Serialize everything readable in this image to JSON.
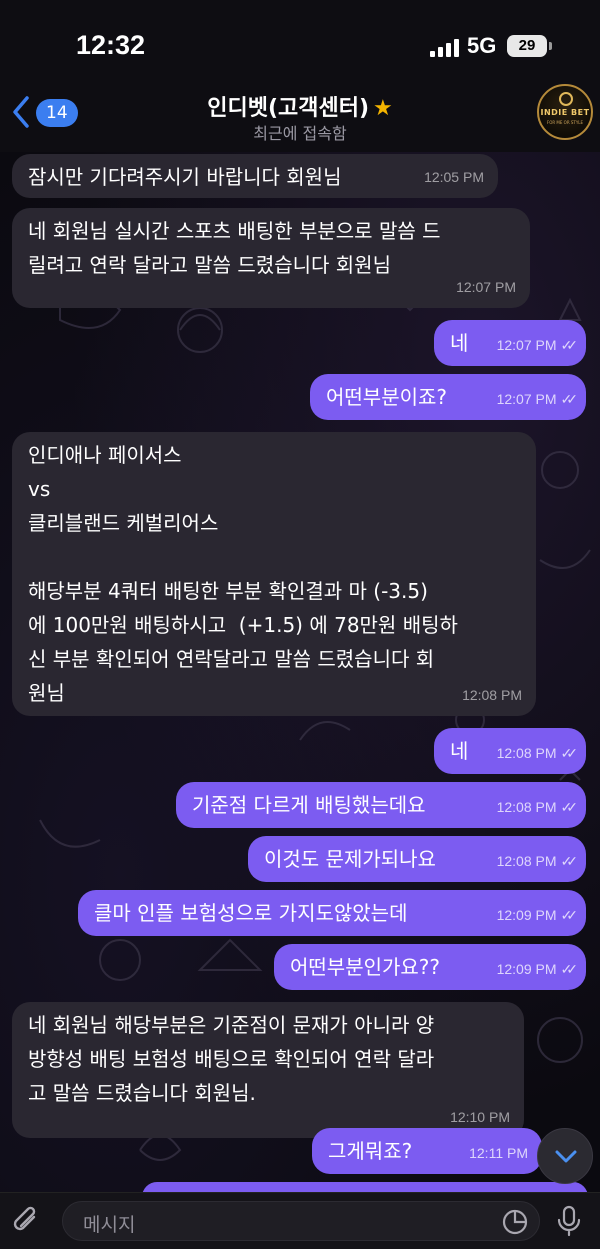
{
  "status": {
    "time": "12:32",
    "network": "5G",
    "battery": "29"
  },
  "header": {
    "back_count": "14",
    "title": "인디벳(고객센터)",
    "subtitle": "최근에 접속함",
    "avatar_text": "INDIE BET",
    "avatar_sub": "FOR ME OR STYLE"
  },
  "messages": [
    {
      "dir": "in",
      "text": "잠시만 기다려주시기 바랍니다 회원님",
      "time": "12:05 PM"
    },
    {
      "dir": "in",
      "text": "네 회원님 실시간 스포츠 배팅한 부분으로 말씀 드\n릴려고 연락 달라고 말씀 드렸습니다 회원님",
      "time": "12:07 PM"
    },
    {
      "dir": "out",
      "text": "네",
      "time": "12:07 PM"
    },
    {
      "dir": "out",
      "text": "어떤부분이죠?",
      "time": "12:07 PM"
    },
    {
      "dir": "in",
      "text": "인디애나 페이서스\nvs\n클리블랜드 케벌리어스\n\n해당부분 4쿼터 배팅한 부분 확인결과 마 (-3.5)\n에 100만원 배팅하시고  (+1.5) 에 78만원 배팅하\n신 부분 확인되어 연락달라고 말씀 드렸습니다 회\n원님",
      "time": "12:08 PM"
    },
    {
      "dir": "out",
      "text": "네",
      "time": "12:08 PM"
    },
    {
      "dir": "out",
      "text": "기준점 다르게 배팅했는데요",
      "time": "12:08 PM"
    },
    {
      "dir": "out",
      "text": "이것도 문제가되나요",
      "time": "12:08 PM"
    },
    {
      "dir": "out",
      "text": "클마 인플 보험성으로 가지도않았는데",
      "time": "12:09 PM"
    },
    {
      "dir": "out",
      "text": "어떤부분인가요??",
      "time": "12:09 PM"
    },
    {
      "dir": "in",
      "text": "네 회원님 해당부분은 기준점이 문재가 아니라 양\n방향성 배팅 보험성 배팅으로 확인되어 연락 달라\n고 말씀 드렸습니다 회원님.",
      "time": "12:10 PM"
    },
    {
      "dir": "out",
      "text": "그게뭐죠?",
      "time": "12:11 PM"
    }
  ],
  "input": {
    "placeholder": "메시지"
  },
  "colors": {
    "incoming": "#2a2731",
    "outgoing": "#7c5cf1",
    "accent": "#3b7ef0"
  },
  "icons": [
    "back-chevron-icon",
    "star-icon",
    "chevron-down-icon",
    "paperclip-icon",
    "sticker-icon",
    "microphone-icon",
    "double-check-icon"
  ]
}
